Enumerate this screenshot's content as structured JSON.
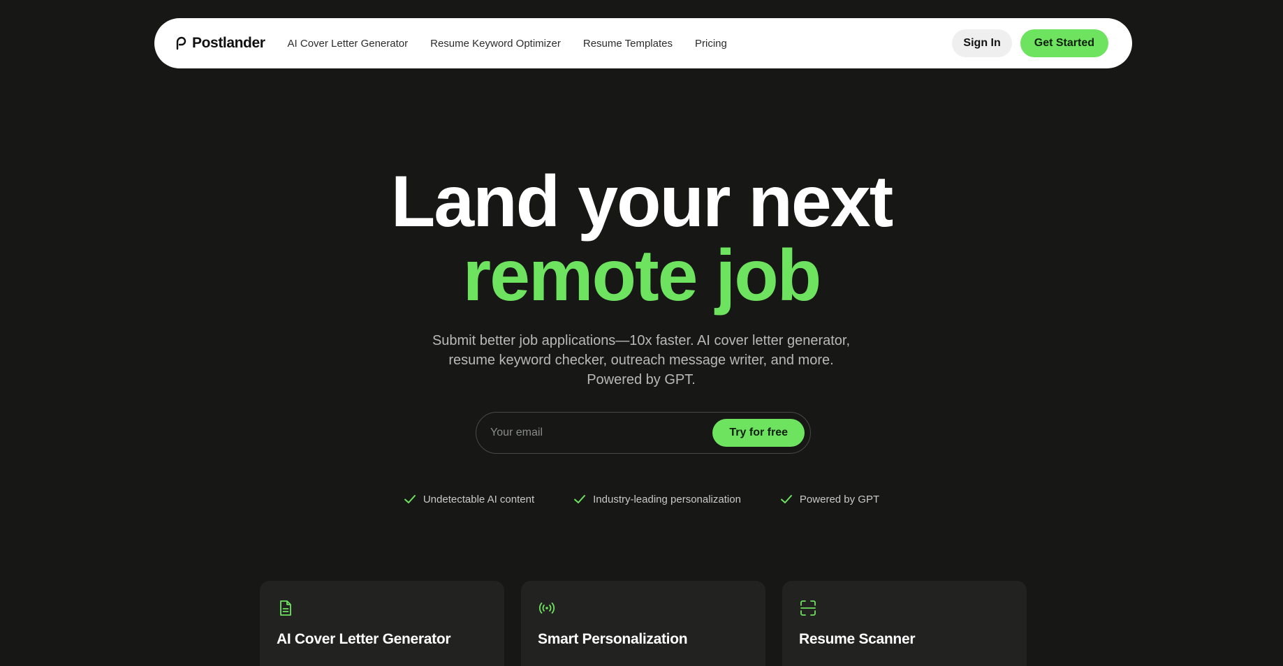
{
  "nav": {
    "logo_text": "Postlander",
    "links": [
      {
        "label": "AI Cover Letter Generator"
      },
      {
        "label": "Resume Keyword Optimizer"
      },
      {
        "label": "Resume Templates"
      },
      {
        "label": "Pricing"
      }
    ],
    "sign_in_label": "Sign In",
    "get_started_label": "Get Started"
  },
  "hero": {
    "line1": "Land your next",
    "line2": "remote job",
    "subtitle": "Submit better job applications—10x faster. AI cover letter generator, resume keyword checker, outreach message writer, and more. Powered by GPT."
  },
  "email_form": {
    "placeholder": "Your email",
    "value": "",
    "button_label": "Try for free"
  },
  "features": [
    {
      "icon": "check-icon",
      "label": "Undetectable AI content"
    },
    {
      "icon": "check-icon",
      "label": "Industry-leading personalization"
    },
    {
      "icon": "check-icon",
      "label": "Powered by GPT"
    }
  ],
  "cards": [
    {
      "icon": "document-icon",
      "title": "AI Cover Letter Generator"
    },
    {
      "icon": "broadcast-icon",
      "title": "Smart Personalization"
    },
    {
      "icon": "scan-icon",
      "title": "Resume Scanner"
    }
  ],
  "colors": {
    "background": "#171816",
    "accent": "#6ee35f",
    "nav_bg": "#ffffff",
    "card_bg": "#222321"
  }
}
